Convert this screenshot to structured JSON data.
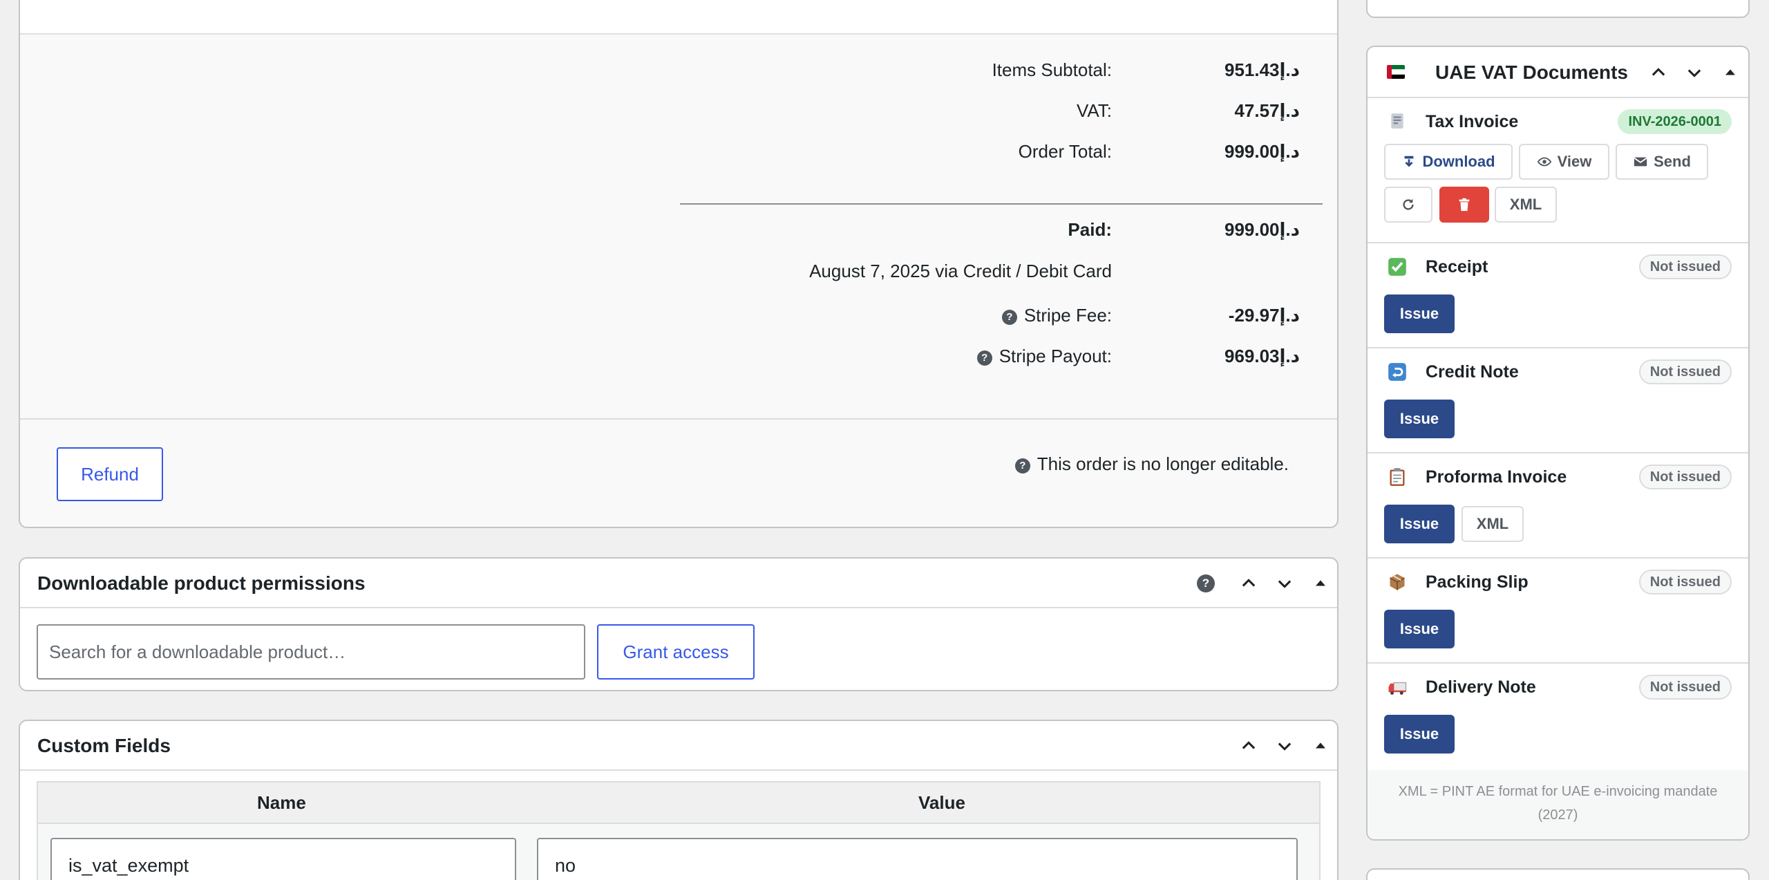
{
  "totals": {
    "items_subtotal_label": "Items Subtotal:",
    "items_subtotal_value": "د.إ951.43",
    "vat_label": "VAT:",
    "vat_value": "د.إ47.57",
    "order_total_label": "Order Total:",
    "order_total_value": "د.إ999.00",
    "paid_label": "Paid:",
    "paid_value": "د.إ999.00",
    "paid_note": "August 7, 2025 via Credit / Debit Card",
    "stripe_fee_label": "Stripe Fee:",
    "stripe_fee_value": "-د.إ29.97",
    "stripe_payout_label": "Stripe Payout:",
    "stripe_payout_value": "د.إ969.03",
    "refund_label": "Refund",
    "not_editable_text": "This order is no longer editable.",
    "help_glyph": "?"
  },
  "downloadable": {
    "title": "Downloadable product permissions",
    "search_placeholder": "Search for a downloadable product…",
    "grant_label": "Grant access"
  },
  "custom_fields": {
    "title": "Custom Fields",
    "col_name": "Name",
    "col_value": "Value",
    "row_name": "is_vat_exempt",
    "row_value": "no"
  },
  "vat_docs": {
    "title": "UAE VAT Documents",
    "documents": [
      {
        "name": "Tax Invoice",
        "icon": "receipt-document-icon",
        "status": "INV-2026-0001",
        "issued": true
      },
      {
        "name": "Receipt",
        "icon": "check-mark-icon",
        "status": "Not issued",
        "issued": false
      },
      {
        "name": "Credit Note",
        "icon": "return-arrow-icon",
        "status": "Not issued",
        "issued": false
      },
      {
        "name": "Proforma Invoice",
        "icon": "clipboard-icon",
        "status": "Not issued",
        "issued": false
      },
      {
        "name": "Packing Slip",
        "icon": "package-icon",
        "status": "Not issued",
        "issued": false
      },
      {
        "name": "Delivery Note",
        "icon": "delivery-truck-icon",
        "status": "Not issued",
        "issued": false
      }
    ],
    "download_label": "Download",
    "view_label": "View",
    "send_label": "Send",
    "xml_label": "XML",
    "issue_label": "Issue",
    "note": "XML = PINT AE format for UAE e-invoicing mandate (2027)"
  },
  "colors": {
    "primary_button": "#2c4a8a",
    "link_blue": "#3858e9",
    "danger": "#e0443b",
    "issued_badge_bg": "#d1f0d8",
    "issued_badge_text": "#1e7a34"
  }
}
